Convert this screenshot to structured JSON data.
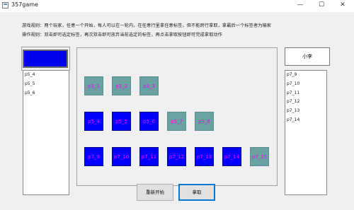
{
  "window": {
    "title": "357game",
    "minimize": "—",
    "maximize": "☐",
    "close": "✕"
  },
  "rules": {
    "game_rules": "游戏规则：两个玩家，任意一个开始，每人可以在一轮内，在任意行里拿任意标签，但不能跨行拿取，拿最后一个标签者为输家",
    "operation_rules": "操作规则：双击即可选定标签，再次双击即可放弃当前选定的标签，再点击拿取按钮即可完成拿取动作"
  },
  "players": {
    "left_name": "",
    "right_name": "小李"
  },
  "left_taken": [
    "p5_4",
    "p5_5",
    "p5_6"
  ],
  "right_taken": [
    "p7_9",
    "p7_10",
    "p7_11",
    "p7_12",
    "p7_13",
    "p7_14"
  ],
  "rows": [
    {
      "tiles": [
        {
          "label": "p3_1",
          "state": "available"
        },
        {
          "label": "p3_2",
          "state": "available"
        },
        {
          "label": "p3_3",
          "state": "available"
        }
      ]
    },
    {
      "tiles": [
        {
          "label": "p5_4",
          "state": "taken"
        },
        {
          "label": "p5_5",
          "state": "taken"
        },
        {
          "label": "p5_6",
          "state": "taken"
        },
        {
          "label": "p5_7",
          "state": "available"
        },
        {
          "label": "p5_8",
          "state": "available"
        }
      ]
    },
    {
      "tiles": [
        {
          "label": "p7_9",
          "state": "taken"
        },
        {
          "label": "p7_10",
          "state": "taken"
        },
        {
          "label": "p7_11",
          "state": "taken"
        },
        {
          "label": "p7_12",
          "state": "taken"
        },
        {
          "label": "p7_13",
          "state": "taken"
        },
        {
          "label": "p7_14",
          "state": "taken"
        },
        {
          "label": "p7_15",
          "state": "available"
        }
      ]
    }
  ],
  "buttons": {
    "restart": "重新开始",
    "take": "拿取"
  },
  "colors": {
    "taken_tile": "#0000ff",
    "available_tile": "#6aa2a2",
    "tile_text": "#ff00ff",
    "current_player": "#0000ee"
  }
}
